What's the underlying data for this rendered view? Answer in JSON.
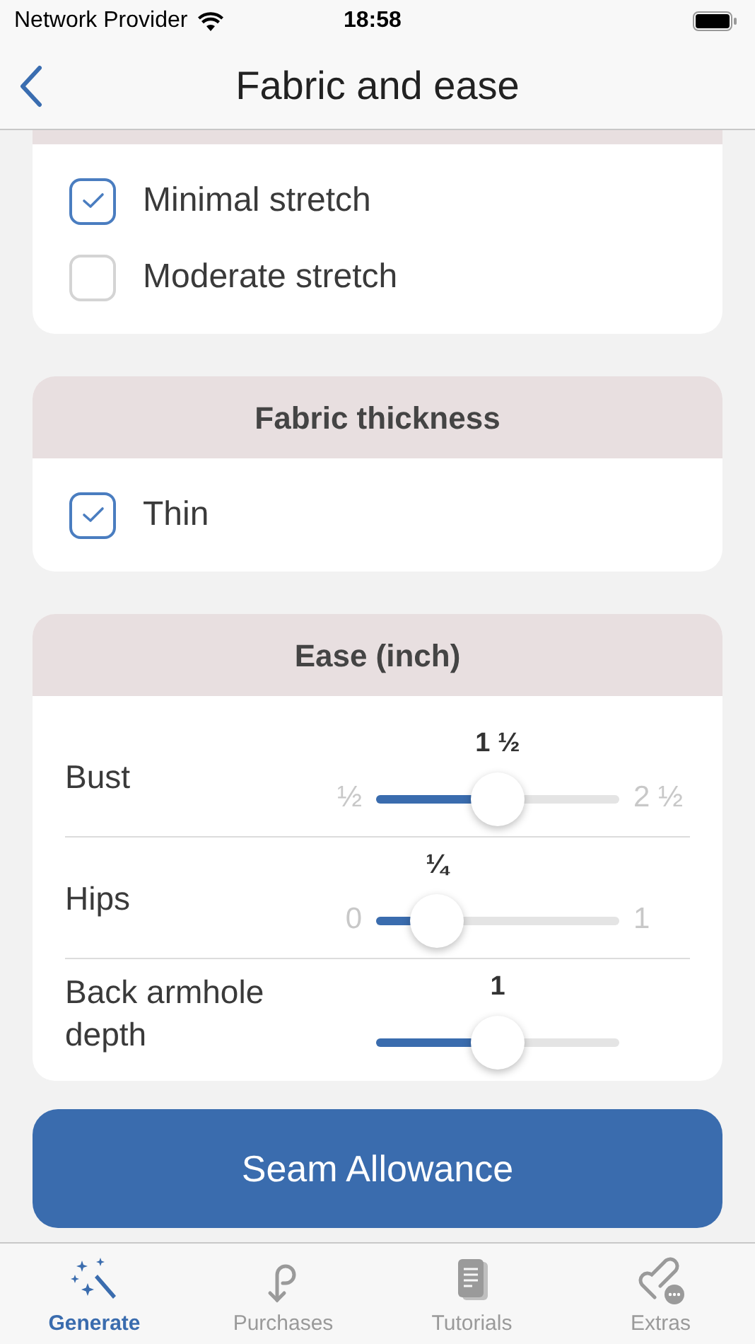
{
  "status_bar": {
    "carrier": "Network Provider",
    "time": "18:58"
  },
  "nav": {
    "title": "Fabric and ease"
  },
  "sections": [
    {
      "kind": "checks",
      "options": [
        {
          "label": "Minimal stretch",
          "checked": true
        },
        {
          "label": "Moderate stretch",
          "checked": false
        }
      ]
    },
    {
      "kind": "checks",
      "title": "Fabric thickness",
      "options": [
        {
          "label": "Thin",
          "checked": true
        }
      ]
    },
    {
      "kind": "sliders",
      "title": "Ease (inch)",
      "sliders": [
        {
          "label": "Bust",
          "value": "1 ½",
          "min": "½",
          "max": "2 ½",
          "level": 0.5
        },
        {
          "label": "Hips",
          "value": "¼",
          "min": "0",
          "max": "1",
          "level": 0.25
        },
        {
          "label": "Back armhole depth",
          "value": "1",
          "level": 0.5
        }
      ]
    }
  ],
  "action_button": "Seam Allowance",
  "tabs": [
    {
      "label": "Generate",
      "selected": true
    },
    {
      "label": "Purchases",
      "selected": false
    },
    {
      "label": "Tutorials",
      "selected": false
    },
    {
      "label": "Extras",
      "selected": false
    }
  ]
}
